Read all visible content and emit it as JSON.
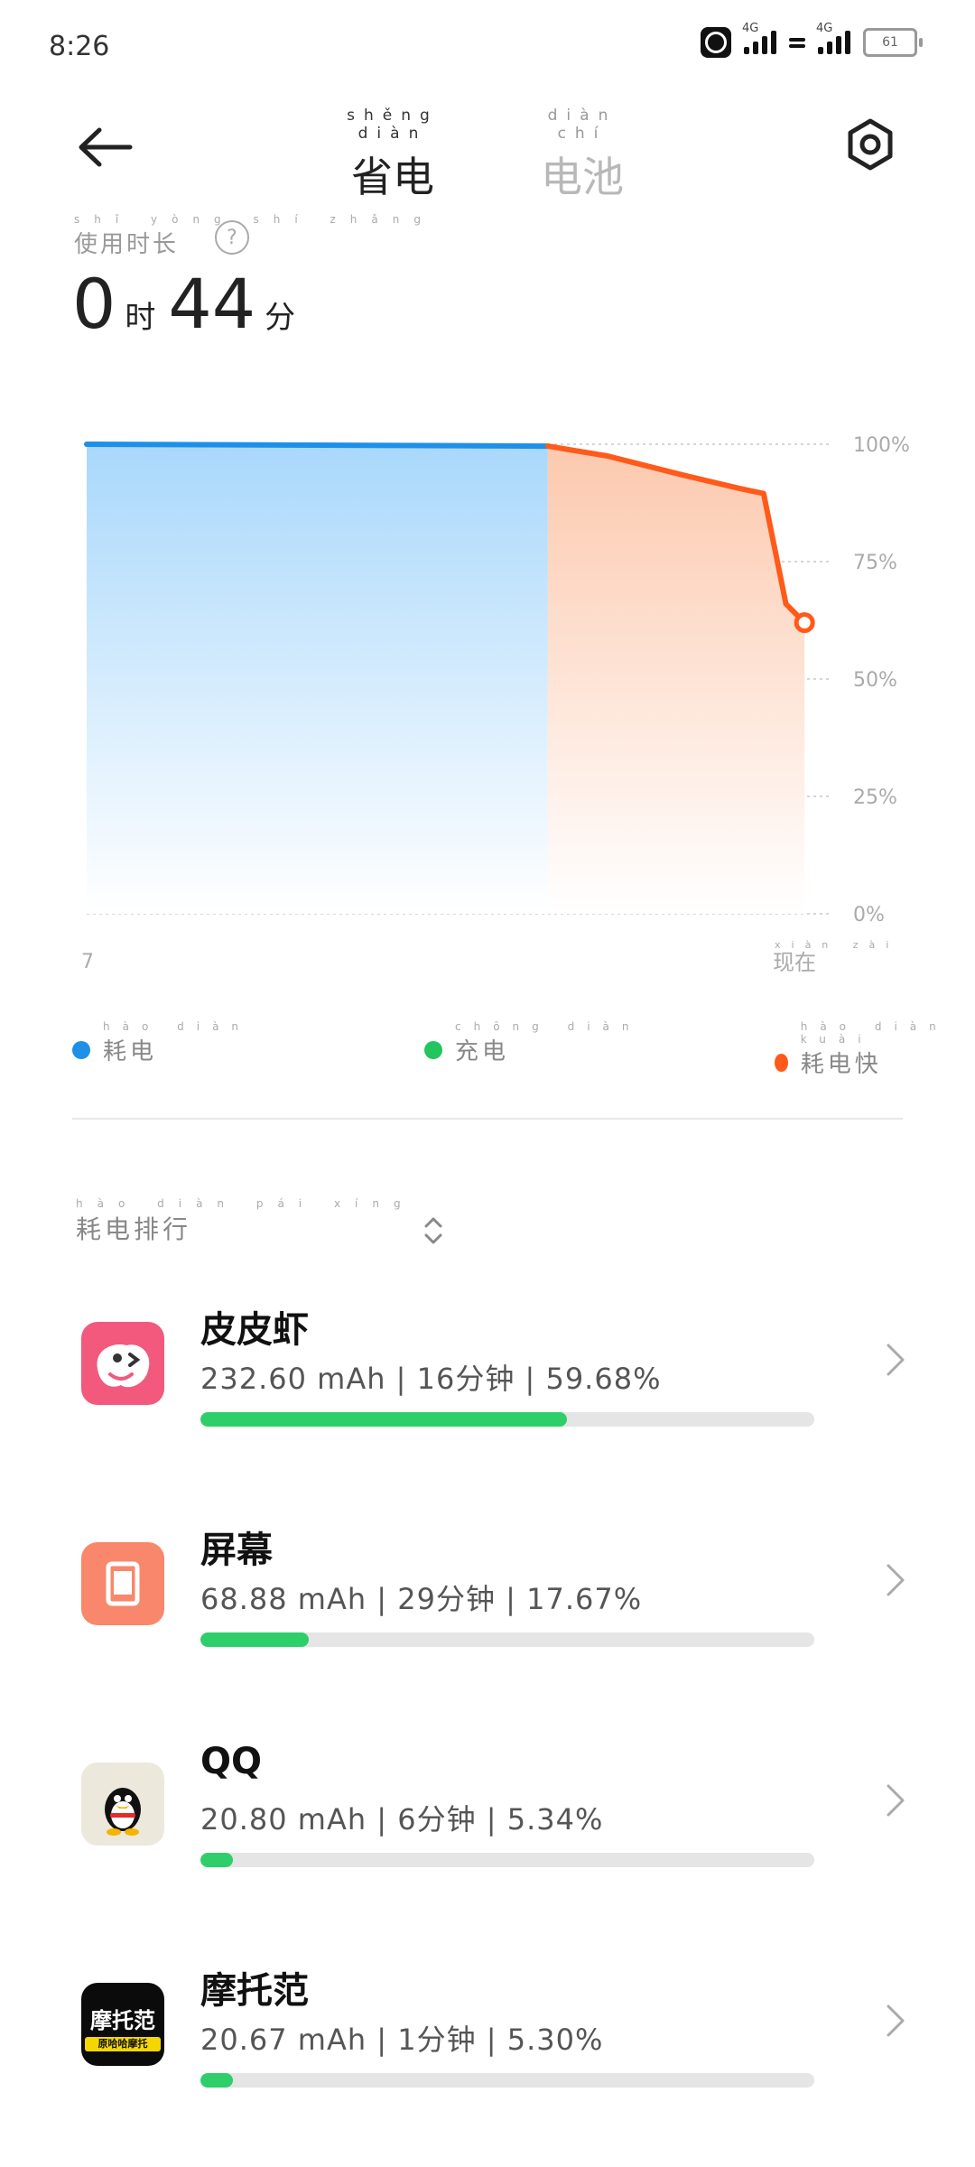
{
  "status": {
    "time": "8:26",
    "net1": "4G",
    "net2": "4G",
    "battery": "61"
  },
  "header": {
    "tab_power": {
      "pinyin": "shěng diàn",
      "label": "省电"
    },
    "tab_battery": {
      "pinyin": "diàn chí",
      "label": "电池"
    }
  },
  "usage": {
    "label_pinyin": "shǐ yòng shí zhǎng",
    "label": "使用时长",
    "hours": "0",
    "hours_unit": "时",
    "minutes": "44",
    "minutes_unit": "分"
  },
  "chart_data": {
    "type": "area",
    "y_ticks": [
      "100%",
      "75%",
      "50%",
      "25%",
      "0%"
    ],
    "x_start_label": "7",
    "x_end_pinyin": "xiàn zài",
    "x_end_label": "现在",
    "ylim": [
      0,
      100
    ],
    "grid": true,
    "series": [
      {
        "name": "耗电",
        "color": "#1e90e8",
        "points": [
          [
            0,
            100
          ],
          [
            0.62,
            99.6
          ]
        ]
      },
      {
        "name": "耗电快",
        "color": "#ff5a1a",
        "points": [
          [
            0.62,
            99.6
          ],
          [
            0.7,
            97.5
          ],
          [
            0.8,
            93.5
          ],
          [
            0.88,
            90.5
          ],
          [
            0.91,
            89.5
          ],
          [
            0.94,
            66
          ],
          [
            0.965,
            62
          ]
        ]
      }
    ]
  },
  "legend": [
    {
      "pinyin": "hào diàn",
      "label": "耗电",
      "color": "#1e90e8"
    },
    {
      "pinyin": "chōng diàn",
      "label": "充电",
      "color": "#22c55e"
    },
    {
      "pinyin": "hào diàn kuài",
      "label": "耗电快",
      "color": "#ff5a1a"
    }
  ],
  "ranking": {
    "pinyin": "hào diàn pái xíng",
    "label": "耗电排行"
  },
  "apps": [
    {
      "name": "皮皮虾",
      "stats": "232.60 mAh | 16分钟 | 59.68%",
      "percent": 59.68
    },
    {
      "name": "屏幕",
      "stats": "68.88 mAh | 29分钟 | 17.67%",
      "percent": 17.67
    },
    {
      "name": "QQ",
      "stats": "20.80 mAh | 6分钟 | 5.34%",
      "percent": 5.34
    },
    {
      "name": "摩托范",
      "stats": "20.67 mAh | 1分钟 | 5.30%",
      "percent": 5.3
    }
  ],
  "icons": {
    "back": "arrow-left-icon",
    "settings": "hex-gear-icon",
    "help": "question-circle-icon",
    "sort": "sort-updown-icon",
    "row": "chevron-right-icon",
    "motuofan_logo_text": "摩托范",
    "motuofan_logo_sub": "原哈哈摩托"
  }
}
